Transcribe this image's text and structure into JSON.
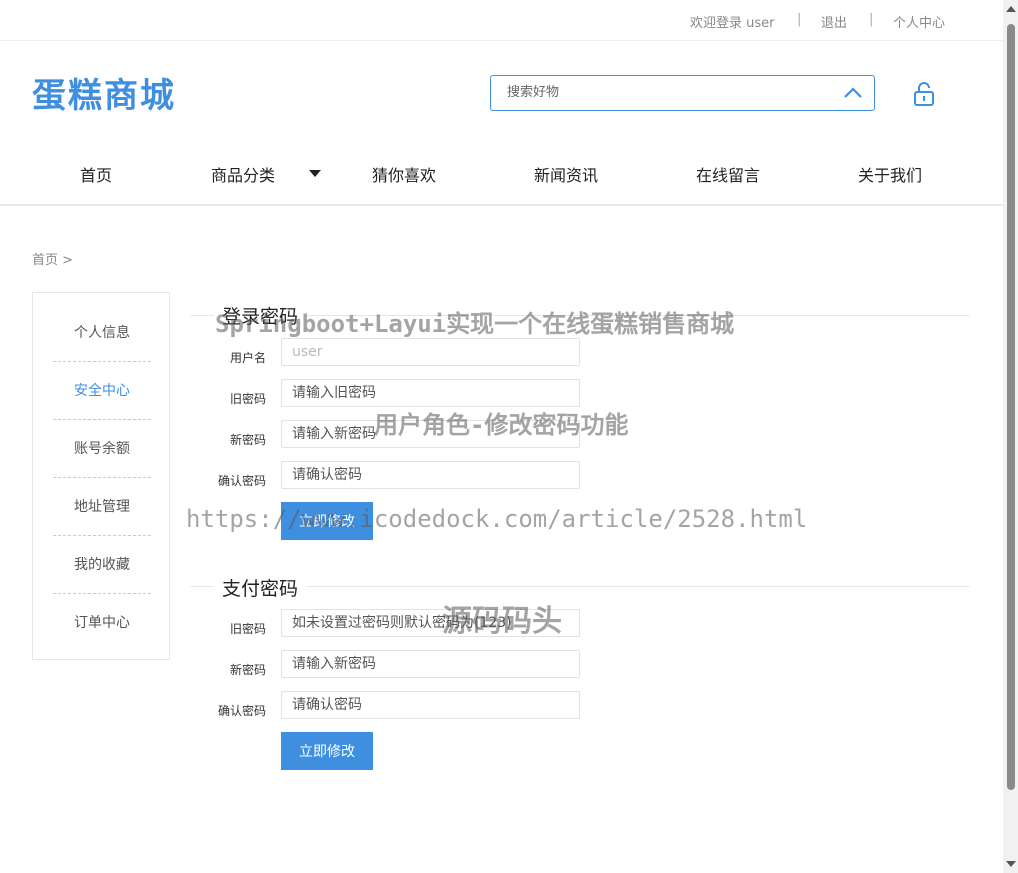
{
  "topbar": {
    "welcome": "欢迎登录 user",
    "sep1": "|",
    "logout": "退出",
    "sep2": "|",
    "user_center": "个人中心"
  },
  "header": {
    "logo": "蛋糕商城",
    "search_placeholder": "搜索好物",
    "search_icon": "chevron-up-icon",
    "lock_icon": "unlock-icon"
  },
  "nav": {
    "items": [
      "首页",
      "商品分类",
      "猜你喜欢",
      "新闻资讯",
      "在线留言",
      "关于我们"
    ]
  },
  "breadcrumb": "首页 >",
  "sidebar": {
    "items": [
      "个人信息",
      "安全中心",
      "账号余额",
      "地址管理",
      "我的收藏",
      "订单中心"
    ],
    "active": "安全中心"
  },
  "login_password": {
    "title": "登录密码",
    "username_label": "用户名",
    "username_placeholder": "user",
    "old_label": "旧密码",
    "old_placeholder": "请输入旧密码",
    "new_label": "新密码",
    "new_placeholder": "请输入新密码",
    "confirm_label": "确认密码",
    "confirm_placeholder": "请确认密码",
    "submit": "立即修改"
  },
  "pay_password": {
    "title": "支付密码",
    "old_label": "旧密码",
    "old_placeholder": "如未设置过密码则默认密码为(123)",
    "new_label": "新密码",
    "new_placeholder": "请输入新密码",
    "confirm_label": "确认密码",
    "confirm_placeholder": "请确认密码",
    "submit": "立即修改"
  },
  "watermarks": {
    "line1": "Springboot+Layui实现一个在线蛋糕销售商城",
    "line2": "用户角色-修改密码功能",
    "line3": "https://www.icodedock.com/article/2528.html",
    "line4": "源码码头"
  },
  "colors": {
    "accent": "#3f8fe0"
  }
}
